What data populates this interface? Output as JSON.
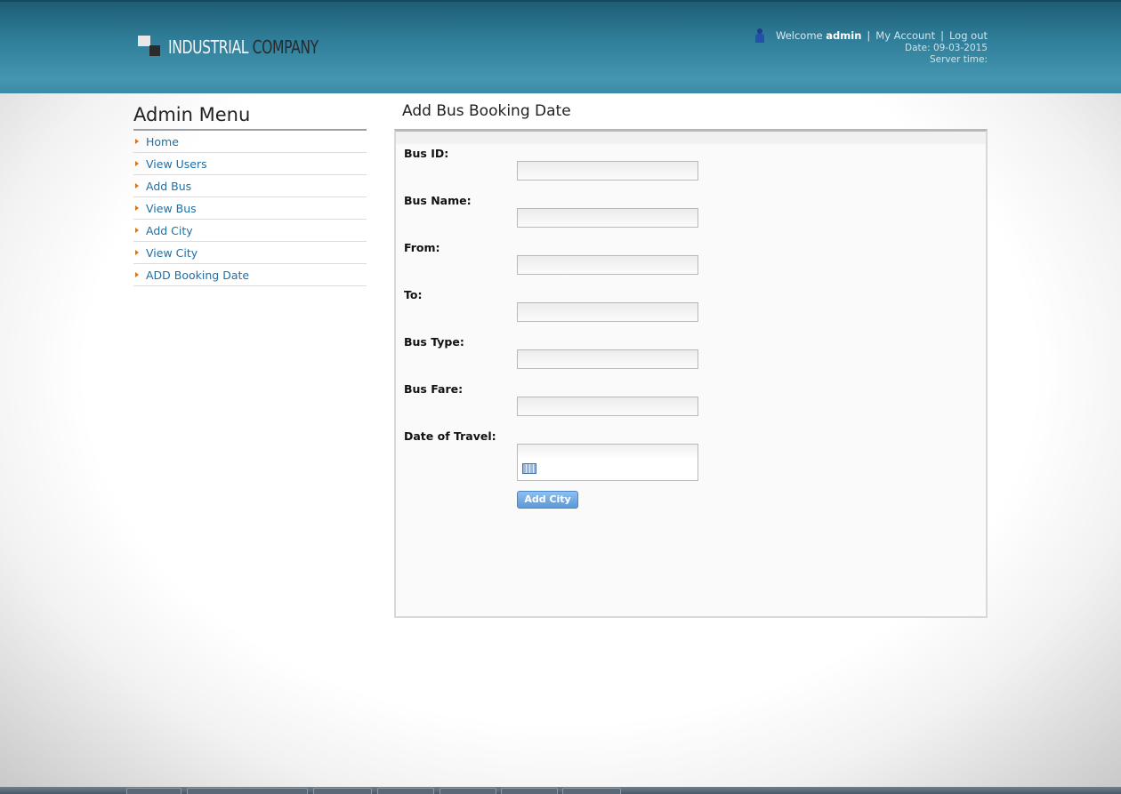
{
  "header": {
    "logo_word1": "INDUSTRIAL",
    "logo_word2": "COMPANY",
    "welcome_prefix": "Welcome",
    "username": "admin",
    "my_account": "My Account",
    "logout": "Log out",
    "date_text": "Date: 09-03-2015",
    "server_time": "Server time:"
  },
  "sidebar": {
    "title": "Admin Menu",
    "items": [
      {
        "label": "Home"
      },
      {
        "label": "View Users"
      },
      {
        "label": "Add Bus"
      },
      {
        "label": "View Bus"
      },
      {
        "label": "Add City"
      },
      {
        "label": "View City"
      },
      {
        "label": "ADD Booking Date"
      }
    ]
  },
  "form": {
    "title": "Add Bus Booking Date",
    "fields": [
      {
        "label": "Bus ID:",
        "value": ""
      },
      {
        "label": "Bus Name:",
        "value": ""
      },
      {
        "label": "From:",
        "value": ""
      },
      {
        "label": "To:",
        "value": ""
      },
      {
        "label": "Bus Type:",
        "value": ""
      },
      {
        "label": "Bus Fare:",
        "value": ""
      },
      {
        "label": "Date of Travel:",
        "value": ""
      }
    ],
    "submit_label": "Add City"
  },
  "colors": {
    "header": "#2f7d98",
    "link": "#1c6fa8",
    "bullet": "#d9731d",
    "button": "#6fa8e2"
  },
  "icons": [
    "user-icon",
    "calendar-icon",
    "menu-bullet-icon"
  ]
}
